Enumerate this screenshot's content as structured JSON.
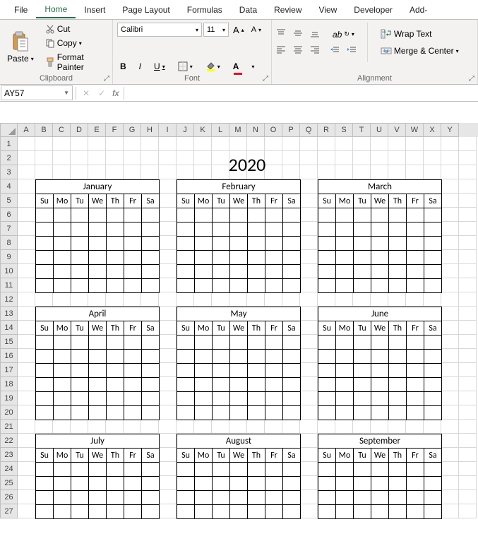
{
  "ribbon_tabs": [
    "File",
    "Home",
    "Insert",
    "Page Layout",
    "Formulas",
    "Data",
    "Review",
    "View",
    "Developer",
    "Add-"
  ],
  "active_tab_index": 1,
  "clipboard": {
    "paste": "Paste",
    "cut": "Cut",
    "copy": "Copy",
    "format_painter": "Format Painter",
    "group_label": "Clipboard"
  },
  "font": {
    "name": "Calibri",
    "size": "11",
    "group_label": "Font"
  },
  "alignment": {
    "wrap": "Wrap Text",
    "merge": "Merge & Center",
    "group_label": "Alignment"
  },
  "name_box": "AY57",
  "columns": [
    "A",
    "B",
    "C",
    "D",
    "E",
    "F",
    "G",
    "H",
    "I",
    "J",
    "K",
    "L",
    "M",
    "N",
    "O",
    "P",
    "Q",
    "R",
    "S",
    "T",
    "U",
    "V",
    "W",
    "X",
    "Y"
  ],
  "rows": [
    "1",
    "2",
    "3",
    "4",
    "5",
    "6",
    "7",
    "8",
    "9",
    "10",
    "11",
    "12",
    "13",
    "14",
    "15",
    "16",
    "17",
    "18",
    "19",
    "20",
    "21",
    "22",
    "23",
    "24",
    "25",
    "26",
    "27"
  ],
  "year": "2020",
  "days": [
    "Su",
    "Mo",
    "Tu",
    "We",
    "Th",
    "Fr",
    "Sa"
  ],
  "months_row1": [
    "January",
    "February",
    "March"
  ],
  "months_row2": [
    "April",
    "May",
    "June"
  ],
  "months_row3": [
    "July",
    "August",
    "September"
  ],
  "cal_body_rows": {
    "row1_row2": 6,
    "row3": 4
  }
}
